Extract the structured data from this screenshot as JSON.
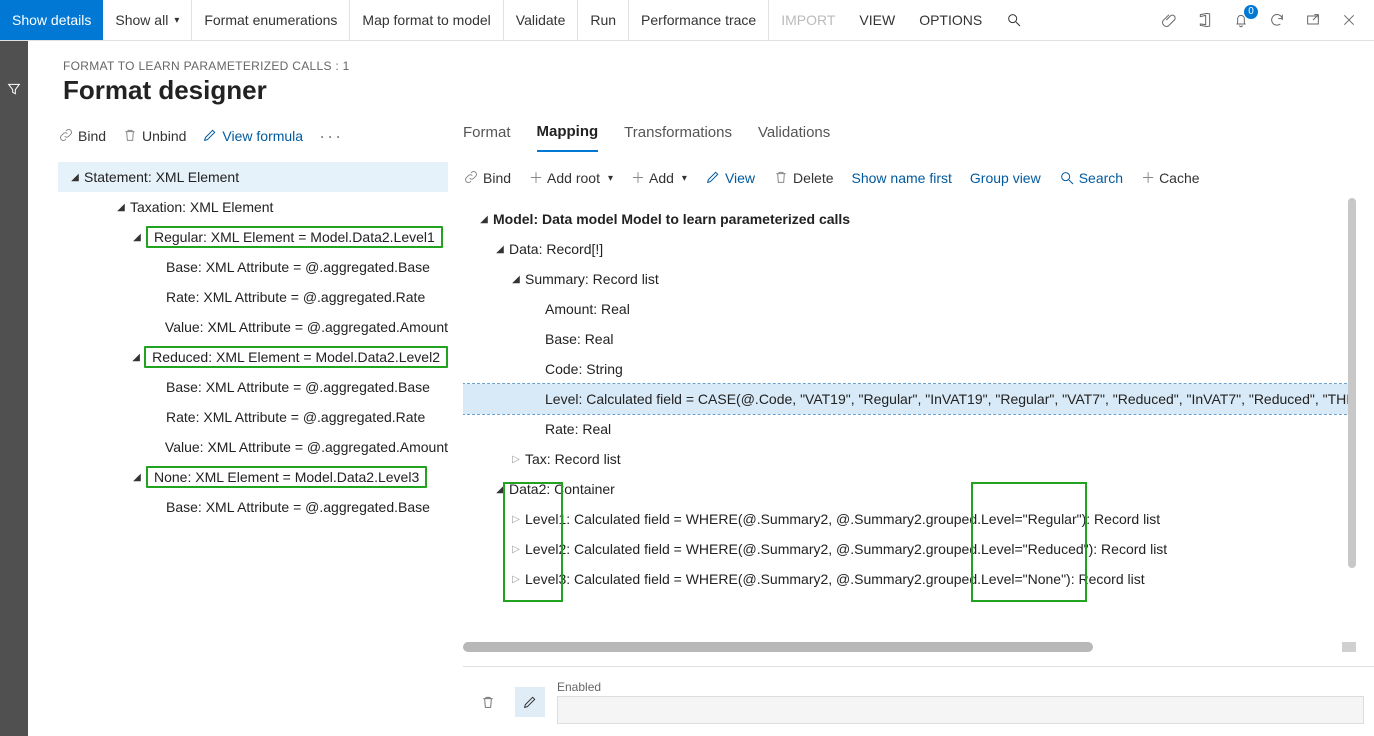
{
  "topbar": {
    "show_details": "Show details",
    "show_all": "Show all",
    "format_enum": "Format enumerations",
    "map_model": "Map format to model",
    "validate": "Validate",
    "run": "Run",
    "perf_trace": "Performance trace",
    "import": "IMPORT",
    "view": "VIEW",
    "options": "OPTIONS",
    "bell_count": "0"
  },
  "breadcrumb": "FORMAT TO LEARN PARAMETERIZED CALLS : 1",
  "page_title": "Format designer",
  "left_bar": {
    "bind": "Bind",
    "unbind": "Unbind",
    "view_formula": "View formula"
  },
  "left_tree": {
    "n0": "Statement: XML Element",
    "n1": "Taxation: XML Element",
    "n2": "Regular: XML Element = Model.Data2.Level1",
    "n2a": "Base: XML Attribute = @.aggregated.Base",
    "n2b": "Rate: XML Attribute = @.aggregated.Rate",
    "n2c": "Value: XML Attribute = @.aggregated.Amount",
    "n3": "Reduced: XML Element = Model.Data2.Level2",
    "n3a": "Base: XML Attribute = @.aggregated.Base",
    "n3b": "Rate: XML Attribute = @.aggregated.Rate",
    "n3c": "Value: XML Attribute = @.aggregated.Amount",
    "n4": "None: XML Element = Model.Data2.Level3",
    "n4a": "Base: XML Attribute = @.aggregated.Base"
  },
  "tabs": {
    "t0": "Format",
    "t1": "Mapping",
    "t2": "Transformations",
    "t3": "Validations"
  },
  "right_bar": {
    "bind": "Bind",
    "add_root": "Add root",
    "add": "Add",
    "view": "View",
    "delete": "Delete",
    "show_name": "Show name first",
    "group_view": "Group view",
    "search": "Search",
    "cache": "Cache"
  },
  "right_tree": {
    "m0": "Model: Data model Model to learn parameterized calls",
    "m1": "Data: Record[!]",
    "m2": "Summary: Record list",
    "m2a": "Amount: Real",
    "m2b": "Base: Real",
    "m2c": "Code: String",
    "m2d": "Level: Calculated field = CASE(@.Code, \"VAT19\", \"Regular\", \"InVAT19\", \"Regular\", \"VAT7\", \"Reduced\", \"InVAT7\", \"Reduced\", \"THI",
    "m2e": "Rate: Real",
    "m3": "Tax: Record list",
    "m4": "Data2: Container",
    "m4a": "Level1: Calculated field = WHERE(@.Summary2, @.Summary2.grouped.Level=\"Regular\"): Record list",
    "m4b": "Level2: Calculated field = WHERE(@.Summary2, @.Summary2.grouped.Level=\"Reduced\"): Record list",
    "m4c": "Level3: Calculated field = WHERE(@.Summary2, @.Summary2.grouped.Level=\"None\"): Record list"
  },
  "bottom": {
    "enabled": "Enabled"
  }
}
